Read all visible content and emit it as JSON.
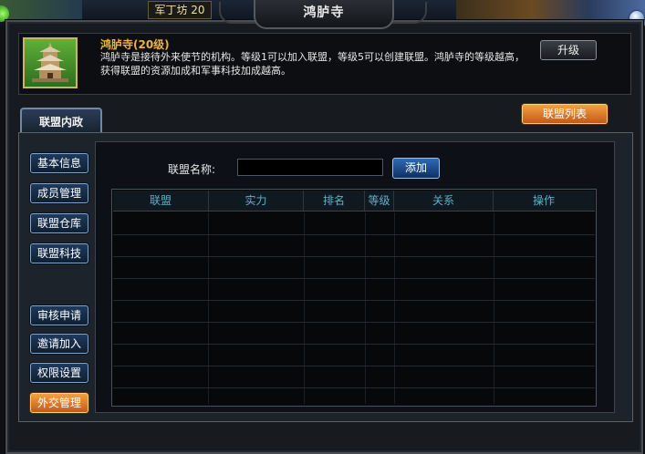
{
  "background": {
    "status_badge": "军丁坊 20"
  },
  "window": {
    "title": "鸿胪寺"
  },
  "info": {
    "title": "鸿胪寺(20级)",
    "description": "鸿胪寺是接待外来使节的机构。等级1可以加入联盟，等级5可以创建联盟。鸿胪寺的等级越高，获得联盟的资源加成和军事科技加成越高。",
    "upgrade_label": "升级"
  },
  "tabs": {
    "main_tab": "联盟内政",
    "list_button": "联盟列表"
  },
  "sidebar": {
    "items": [
      {
        "label": "基本信息",
        "active": false
      },
      {
        "label": "成员管理",
        "active": false
      },
      {
        "label": "联盟仓库",
        "active": false
      },
      {
        "label": "联盟科技",
        "active": false
      },
      {
        "label": "审核申请",
        "active": false
      },
      {
        "label": "邀请加入",
        "active": false
      },
      {
        "label": "权限设置",
        "active": false
      },
      {
        "label": "外交管理",
        "active": true
      }
    ]
  },
  "form": {
    "name_label": "联盟名称:",
    "name_value": "",
    "add_label": "添加"
  },
  "table": {
    "headers": [
      "联盟",
      "实力",
      "排名",
      "等级",
      "关系",
      "操作"
    ],
    "rows": []
  },
  "colors": {
    "accent_orange": "#e0802a",
    "header_text": "#5fb0c8",
    "title_gold": "#f0b040"
  }
}
